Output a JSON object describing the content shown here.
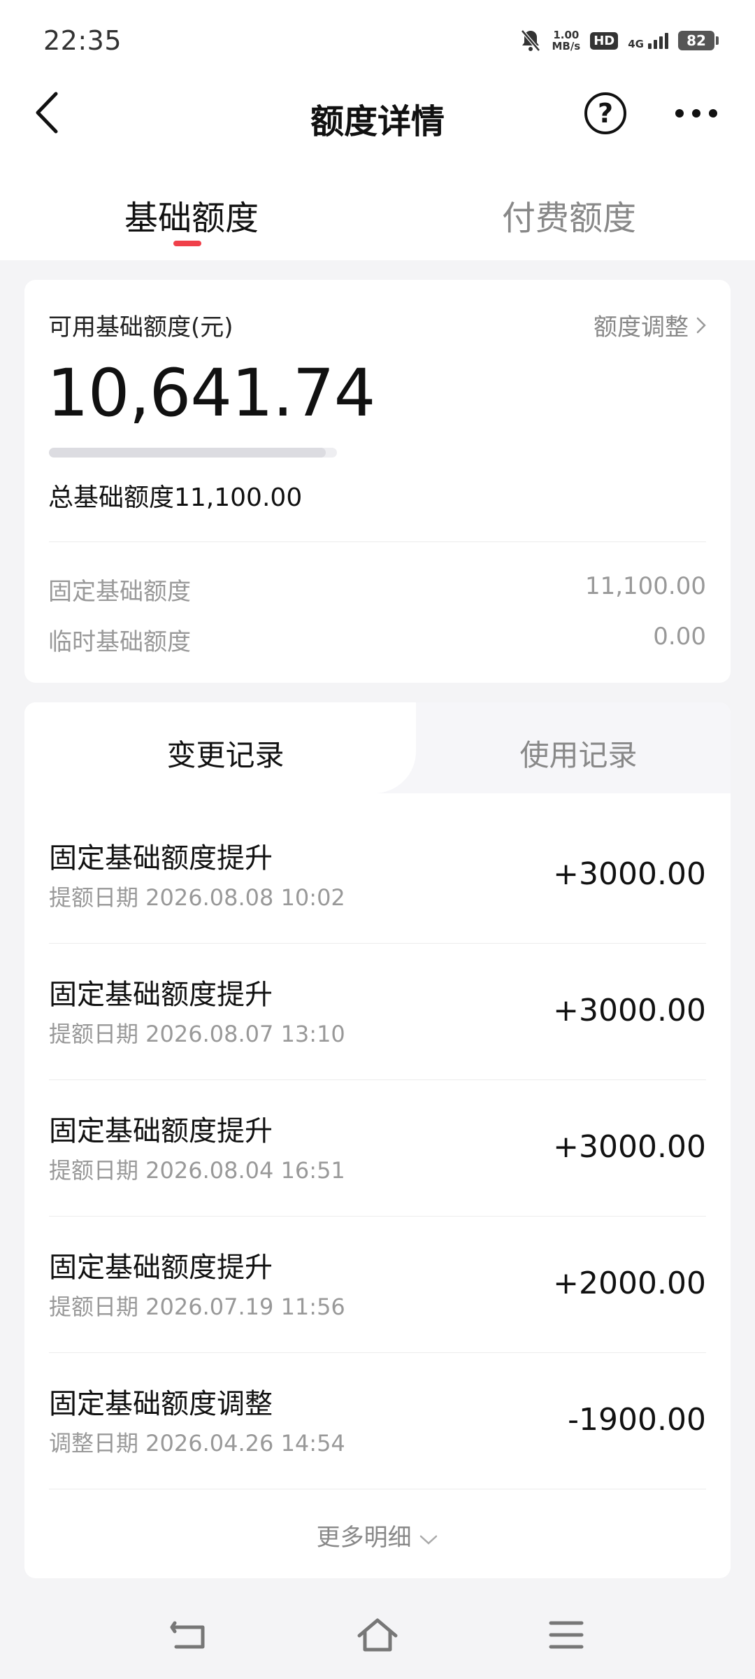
{
  "status_bar": {
    "time": "22:35",
    "speed_top": "1.00",
    "speed_bottom": "MB/s",
    "hd": "HD",
    "network": "4G",
    "battery": "82"
  },
  "nav": {
    "title": "额度详情"
  },
  "tabs": {
    "basic": "基础额度",
    "paid": "付费额度"
  },
  "balance": {
    "label": "可用基础额度(元)",
    "adjust_link": "额度调整",
    "available": "10,641.74",
    "used_fraction": 0.96,
    "total_label": "总基础额度11,100.00",
    "fixed_label": "固定基础额度",
    "fixed_value": "11,100.00",
    "temp_label": "临时基础额度",
    "temp_value": "0.00"
  },
  "records": {
    "tab_changes": "变更记录",
    "tab_usage": "使用记录",
    "items": [
      {
        "title": "固定基础额度提升",
        "date": "提额日期 2026.08.08 10:02",
        "amount": "+3000.00"
      },
      {
        "title": "固定基础额度提升",
        "date": "提额日期 2026.08.07 13:10",
        "amount": "+3000.00"
      },
      {
        "title": "固定基础额度提升",
        "date": "提额日期 2026.08.04 16:51",
        "amount": "+3000.00"
      },
      {
        "title": "固定基础额度提升",
        "date": "提额日期 2026.07.19 11:56",
        "amount": "+2000.00"
      },
      {
        "title": "固定基础额度调整",
        "date": "调整日期 2026.04.26 14:54",
        "amount": "-1900.00"
      }
    ],
    "more_label": "更多明细"
  },
  "colors": {
    "accent": "#f0404a",
    "text_primary": "#111111",
    "text_secondary": "#999999",
    "background": "#f4f4f6"
  }
}
